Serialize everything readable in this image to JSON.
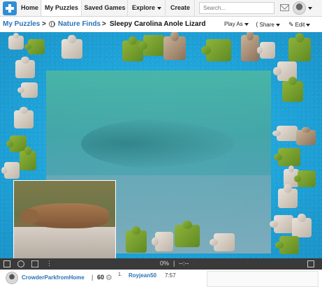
{
  "nav": {
    "items": [
      "Home",
      "My Puzzles",
      "Saved Games",
      "Explore",
      "Create"
    ],
    "active": "My Puzzles",
    "search_placeholder": "Search..."
  },
  "titlebar": {
    "crumb1": "My Puzzles",
    "sep1": ">",
    "crumb2": "Nature Finds",
    "sep2": ">",
    "title": "Sleepy Carolina Anole Lizard",
    "play_as": "Play As",
    "share": "Share",
    "edit": "Edit"
  },
  "status": {
    "progress": "0%",
    "divider": "|",
    "timer": "--:--"
  },
  "footer": {
    "user": "CrowderParkfromHome",
    "separator": "|",
    "count": "60",
    "rank": "1.",
    "leader": "Royjean50",
    "leader_time": "7:57"
  },
  "colors": {
    "board_blue": "#1ea2d8",
    "link_blue": "#2a72b5",
    "status_bar": "#3a3a3a"
  },
  "icons": [
    "puzzle-logo-icon",
    "mail-icon",
    "globe-icon",
    "share-icon",
    "edit-icon",
    "image-icon",
    "ghost-icon",
    "grid-icon",
    "menu-dots-icon",
    "fullscreen-icon",
    "gear-icon"
  ]
}
